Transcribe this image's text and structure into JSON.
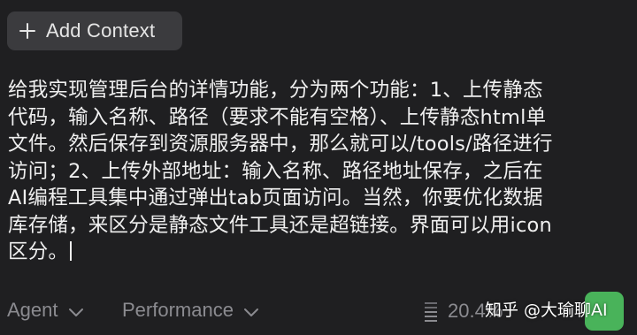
{
  "toolbar": {
    "add_context_label": "Add Context",
    "add_context_icon": "plus-icon"
  },
  "prompt": {
    "lines": [
      "给我实现管理后台的详情功能，分为两个功能：1、上传静态",
      "代码，输入名称、路径（要求不能有空格）、上传静态html单",
      "文件。然后保存到资源服务器中，那么就可以/tools/路径进行",
      "访问；2、上传外部地址：输入名称、路径地址保存，之后在",
      "AI编程工具集中通过弹出tab页面访问。当然，你要优化数据",
      "库存储，来区分是静态文件工具还是超链接。界面可以用icon",
      "区分。"
    ]
  },
  "bottom_bar": {
    "mode_label": "Agent",
    "model_label": "Performance",
    "usage_percent": "20.4%",
    "watermark": "知乎 @大瑜聊AI",
    "send_color": "#49b35a"
  },
  "colors": {
    "background": "#1f1f21",
    "chip": "#3b3b3e",
    "muted_text": "#8b8b90",
    "accent_green": "#49b35a"
  }
}
